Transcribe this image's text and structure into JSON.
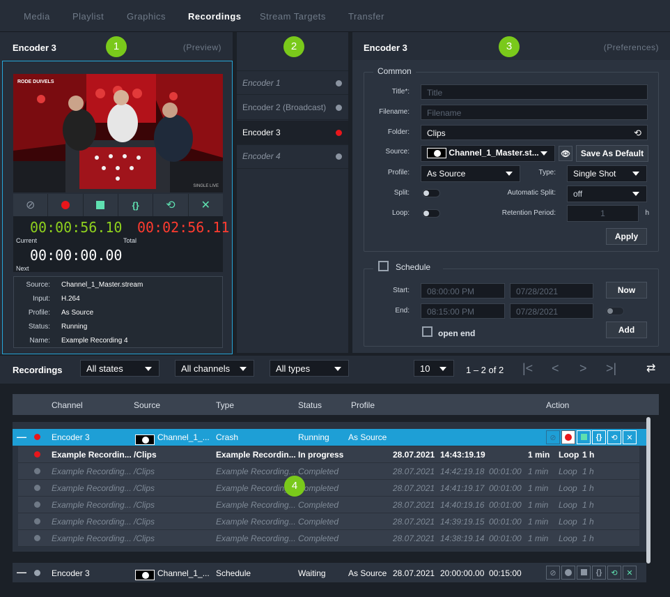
{
  "nav": {
    "tabs": [
      "Media",
      "Playlist",
      "Graphics",
      "Recordings",
      "Stream Targets",
      "Transfer"
    ],
    "active": 3
  },
  "preview": {
    "title": "Encoder 3",
    "sub": "(Preview)",
    "badge": "1",
    "current_time": "00:00:56.10",
    "total_time": "00:02:56.11",
    "next_time": "00:00:00.00",
    "current_label": "Current",
    "total_label": "Total",
    "next_label": "Next",
    "info": [
      {
        "k": "Source:",
        "v": "Channel_1_Master.stream"
      },
      {
        "k": "Input:",
        "v": "H.264"
      },
      {
        "k": "Profile:",
        "v": "As Source"
      },
      {
        "k": "Status:",
        "v": "Running"
      },
      {
        "k": "Name:",
        "v": "Example Recording 4"
      }
    ],
    "video_text": "RODE DUIVELS",
    "video_logo": "SINGLE LIVE"
  },
  "encoders": {
    "badge": "2",
    "items": [
      {
        "label": "Encoder 1",
        "dot": "#8a93a0"
      },
      {
        "label": "Encoder 2 (Broadcast)",
        "dot": "#8a93a0"
      },
      {
        "label": "Encoder 3",
        "dot": "#e8161b"
      },
      {
        "label": "Encoder 4",
        "dot": "#8a93a0"
      }
    ]
  },
  "prefs": {
    "title": "Encoder 3",
    "sub": "(Preferences)",
    "badge": "3",
    "common": "Common",
    "title_label": "Title*:",
    "title_ph": "Title",
    "filename_label": "Filename:",
    "filename_ph": "Filename",
    "folder_label": "Folder:",
    "folder_val": "Clips",
    "source_label": "Source:",
    "source_val": "Channel_1_Master.st...",
    "save_default": "Save As Default",
    "profile_label": "Profile:",
    "profile_val": "As Source",
    "type_label": "Type:",
    "type_val": "Single Shot",
    "split_label": "Split:",
    "auto_split_label": "Automatic Split:",
    "auto_split_val": "off",
    "loop_label": "Loop:",
    "retention_label": "Retention Period:",
    "retention_val": "1",
    "retention_unit": "h",
    "apply": "Apply",
    "schedule": "Schedule",
    "start_label": "Start:",
    "start_time": "08:00:00 PM",
    "start_date": "07/28/2021",
    "end_label": "End:",
    "end_time": "08:15:00 PM",
    "end_date": "07/28/2021",
    "now": "Now",
    "add": "Add",
    "open_end": "open end"
  },
  "recordings": {
    "title": "Recordings",
    "f_states": "All states",
    "f_channels": "All channels",
    "f_types": "All types",
    "per_page": "10",
    "page_info": "1 – 2 of 2",
    "badge": "4",
    "headers": [
      "Channel",
      "Source",
      "Type",
      "Status",
      "Profile",
      "Action"
    ],
    "group1": {
      "channel": "Encoder 3",
      "source": "Channel_1_...",
      "type": "Crash",
      "status": "Running",
      "profile": "As Source"
    },
    "subrows": [
      {
        "name": "Example Recordin...",
        "folder": "/Clips",
        "type": "Example Recordin...",
        "status": "In progress",
        "date": "28.07.2021",
        "start": "14:43:19.19",
        "dur": "",
        "split": "1 min",
        "loop": "Loop",
        "ret": "1 h",
        "active": true
      },
      {
        "name": "Example Recording...",
        "folder": "/Clips",
        "type": "Example Recording...",
        "status": "Completed",
        "date": "28.07.2021",
        "start": "14:42:19.18",
        "dur": "00:01:00",
        "split": "1 min",
        "loop": "Loop",
        "ret": "1 h",
        "active": false
      },
      {
        "name": "Example Recording...",
        "folder": "/Clips",
        "type": "Example Recording...",
        "status": "Completed",
        "date": "28.07.2021",
        "start": "14:41:19.17",
        "dur": "00:01:00",
        "split": "1 min",
        "loop": "Loop",
        "ret": "1 h",
        "active": false
      },
      {
        "name": "Example Recording...",
        "folder": "/Clips",
        "type": "Example Recording...",
        "status": "Completed",
        "date": "28.07.2021",
        "start": "14:40:19.16",
        "dur": "00:01:00",
        "split": "1 min",
        "loop": "Loop",
        "ret": "1 h",
        "active": false
      },
      {
        "name": "Example Recording...",
        "folder": "/Clips",
        "type": "Example Recording...",
        "status": "Completed",
        "date": "28.07.2021",
        "start": "14:39:19.15",
        "dur": "00:01:00",
        "split": "1 min",
        "loop": "Loop",
        "ret": "1 h",
        "active": false
      },
      {
        "name": "Example Recording...",
        "folder": "/Clips",
        "type": "Example Recording...",
        "status": "Completed",
        "date": "28.07.2021",
        "start": "14:38:19.14",
        "dur": "00:01:00",
        "split": "1 min",
        "loop": "Loop",
        "ret": "1 h",
        "active": false
      }
    ],
    "group2": {
      "channel": "Encoder 3",
      "source": "Channel_1_...",
      "type": "Schedule",
      "status": "Waiting",
      "profile": "As Source",
      "date": "28.07.2021",
      "start": "20:00:00.00",
      "dur": "00:15:00"
    }
  },
  "colors": {
    "accent": "#26a6d9",
    "green": "#7ac91b",
    "red": "#e8161b",
    "timer_green": "#8fd11e",
    "timer_red": "#ff3b2f",
    "highlight": "#1e9fd6"
  }
}
